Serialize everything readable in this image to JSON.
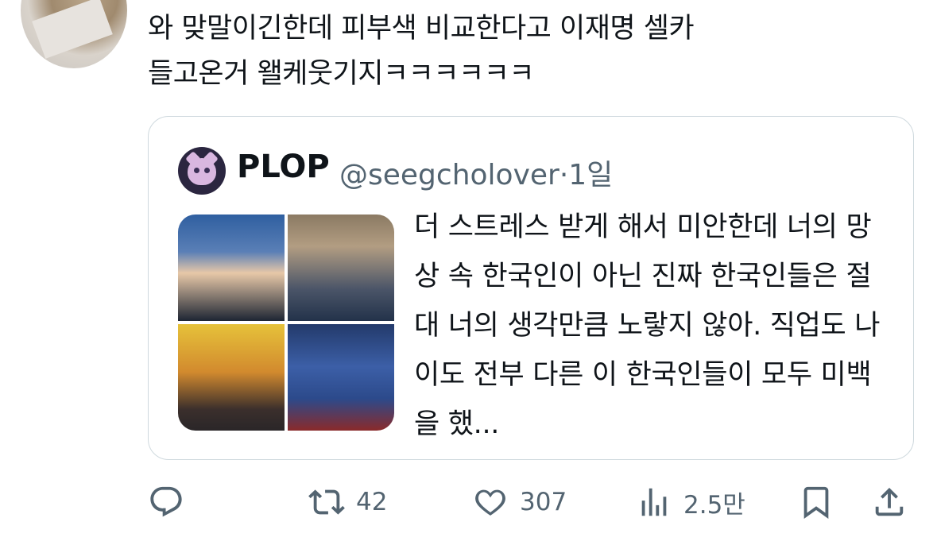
{
  "tweet": {
    "text_line1": "와 맞말이긴한데 피부색 비교한다고 이재명 셀카",
    "text_line2": "들고온거 왤케웃기지ㅋㅋㅋㅋㅋㅋ"
  },
  "quote": {
    "name": "PLOP",
    "handle": "@seegcholover",
    "time": "·1일",
    "body": "더 스트레스 받게 해서 미안한데 너의 망상 속 한국인이 아닌 진짜 한국인들은 절대 너의 생각만큼 노랗지 않아. 직업도 나이도 전부 다른 이 한국인들이 모두 미백을 했..."
  },
  "actions": {
    "replies": "",
    "retweets": "42",
    "likes": "307",
    "views": "2.5만"
  },
  "icons": {
    "reply": "reply-icon",
    "retweet": "retweet-icon",
    "like": "heart-icon",
    "views": "views-icon",
    "bookmark": "bookmark-icon",
    "share": "share-icon"
  },
  "colors": {
    "text": "#0f1419",
    "secondary": "#536471",
    "border": "#cfd9de"
  }
}
